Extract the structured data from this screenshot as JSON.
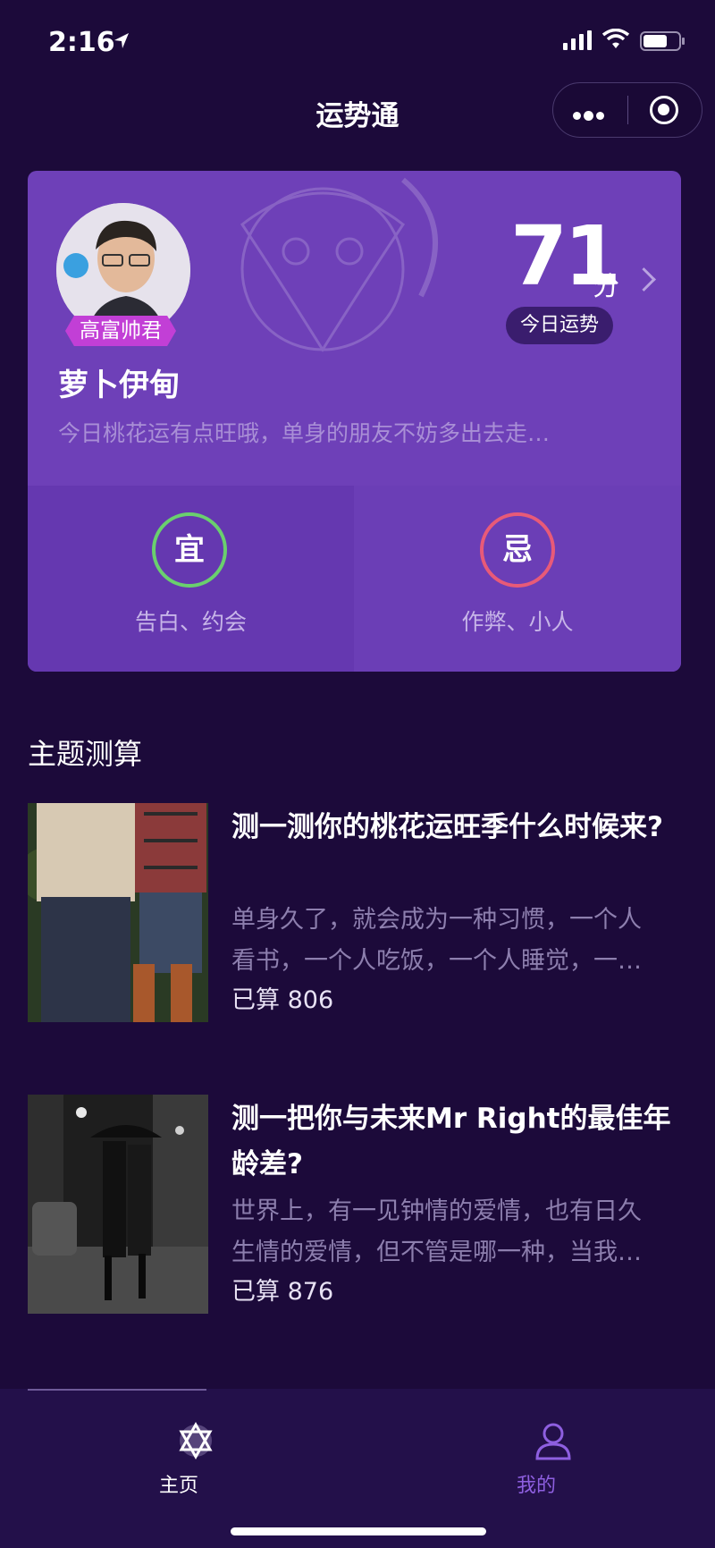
{
  "status": {
    "time": "2:16"
  },
  "nav": {
    "title": "运势通"
  },
  "fortune": {
    "badge": "高富帅君",
    "username": "萝卜伊甸",
    "tip": "今日桃花运有点旺哦，单身的朋友不妨多出去走…",
    "score": "71",
    "score_unit": "分",
    "today_label": "今日运势",
    "yi": {
      "char": "宜",
      "text": "告白、约会"
    },
    "ji": {
      "char": "忌",
      "text": "作弊、小人"
    }
  },
  "section": {
    "title": "主题测算",
    "items": [
      {
        "title": "测一测你的桃花运旺季什么时候来?",
        "desc_line1": "单身久了，就会成为一种习惯，一个人",
        "desc_line2": "看书，一个人吃饭，一个人睡觉，一…",
        "count": "已算 806"
      },
      {
        "title": "测一把你与未来Mr Right的最佳年龄差?",
        "desc_line1": "世界上，有一见钟情的爱情，也有日久",
        "desc_line2": "生情的爱情，但不管是哪一种，当我…",
        "count": "已算 876"
      }
    ]
  },
  "tabbar": {
    "home": "主页",
    "mine": "我的"
  },
  "colors": {
    "background": "#1c0a3a",
    "card": "#6e40b8",
    "yi_ring": "#6ad06e",
    "ji_ring": "#e85a78",
    "badge": "#c23fd6",
    "tab_active": "#ffffff",
    "tab_inactive": "#8e5fe0"
  }
}
